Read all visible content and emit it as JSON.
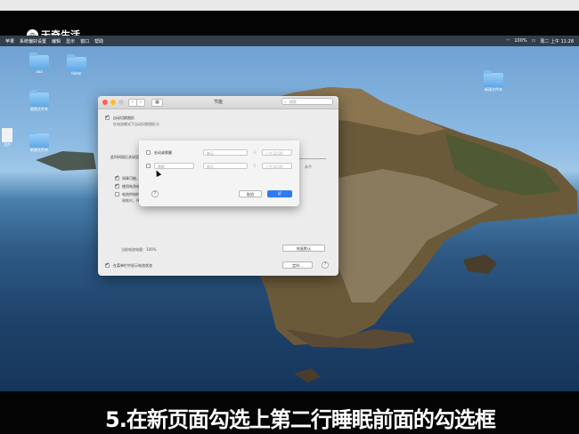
{
  "watermark": {
    "icon": "tianqi-logo-icon",
    "text": "天奇生活"
  },
  "menubar": {
    "left": [
      "苹果",
      "系统偏好设置",
      "编辑",
      "显示",
      "窗口",
      "帮助"
    ],
    "right": [
      "100%",
      "周二 上午 11:28"
    ]
  },
  "desktop_icons": [
    {
      "label": "aaa",
      "kind": "folder"
    },
    {
      "label": "folder",
      "kind": "folder"
    },
    {
      "label": "截图文件夹",
      "kind": "folder"
    },
    {
      "label": "文件",
      "kind": "document"
    },
    {
      "label": "新建文件夹",
      "kind": "folder"
    },
    {
      "label": "新建文件夹",
      "kind": "folder"
    }
  ],
  "window": {
    "title": "节能",
    "search_placeholder": "搜索",
    "auto_switch_label": "自动切换图形",
    "auto_switch_desc": "在电池模式下自动切换图形卡",
    "sleep_label": "此时间段后关闭显示器",
    "slider_end": "永不",
    "options": [
      {
        "label": "如果可能，使硬盘进入睡眠",
        "checked": true
      },
      {
        "label": "使用电池电源时使显示屏略微变暗",
        "checked": true
      },
      {
        "label": "电池供电时启用电能小憩",
        "checked": false
      }
    ],
    "power_nap_desc": "睡眠时，Mac可以定期检查新邮件、日历和其他iCloud更新",
    "battery_status": "当前电池电量：100%",
    "restore_defaults": "恢复默认",
    "schedule_button": "定时...",
    "show_battery_status": "在菜单栏中显示电池状态",
    "help": "?"
  },
  "schedule_sheet": {
    "row1": {
      "label": "启动或唤醒",
      "day": "每天",
      "time": "上午12:00"
    },
    "row2": {
      "label": "睡眠",
      "day": "每天",
      "time": "上午12:00"
    },
    "cancel": "取消",
    "ok": "好",
    "help": "?"
  },
  "subtitle": "5.在新页面勾选上第二行睡眠前面的勾选框"
}
